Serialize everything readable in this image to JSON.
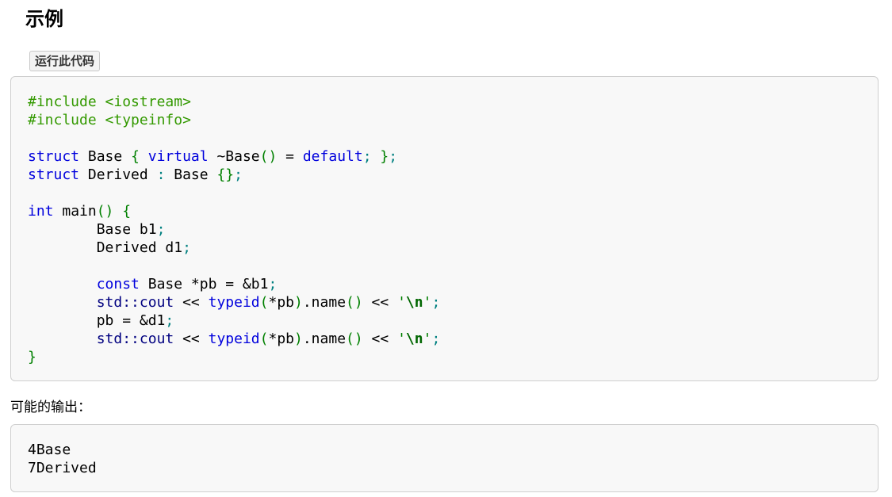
{
  "heading": "示例",
  "run_button": "运行此代码",
  "code": {
    "inc1_kw": "#include ",
    "inc1_hdr": "<iostream>",
    "inc2_kw": "#include ",
    "inc2_hdr": "<typeinfo>",
    "struct_kw": "struct",
    "base_name": " Base ",
    "virtual_kw": "virtual",
    "dtor": " ~Base",
    "eq": " = ",
    "default_kw": "default",
    "derived_name": " Derived ",
    "colon": ":",
    "base_ref": " Base ",
    "int_kw": "int",
    "main_name": " main",
    "indent": "        ",
    "base_b1": "Base b1",
    "derived_d1": "Derived d1",
    "const_kw": "const",
    "pb_decl": " Base *pb = &b1",
    "std_ns": "std::",
    "cout": "cout",
    "shift": " << ",
    "typeid_kw": "typeid",
    "deref_pb": "*pb",
    "name_call": ".name",
    "newline_esc": "\\n",
    "pb_assign": "pb = &d1"
  },
  "output_label": "可能的输出：",
  "output_lines": {
    "l1": "4Base",
    "l2": "7Derived"
  }
}
